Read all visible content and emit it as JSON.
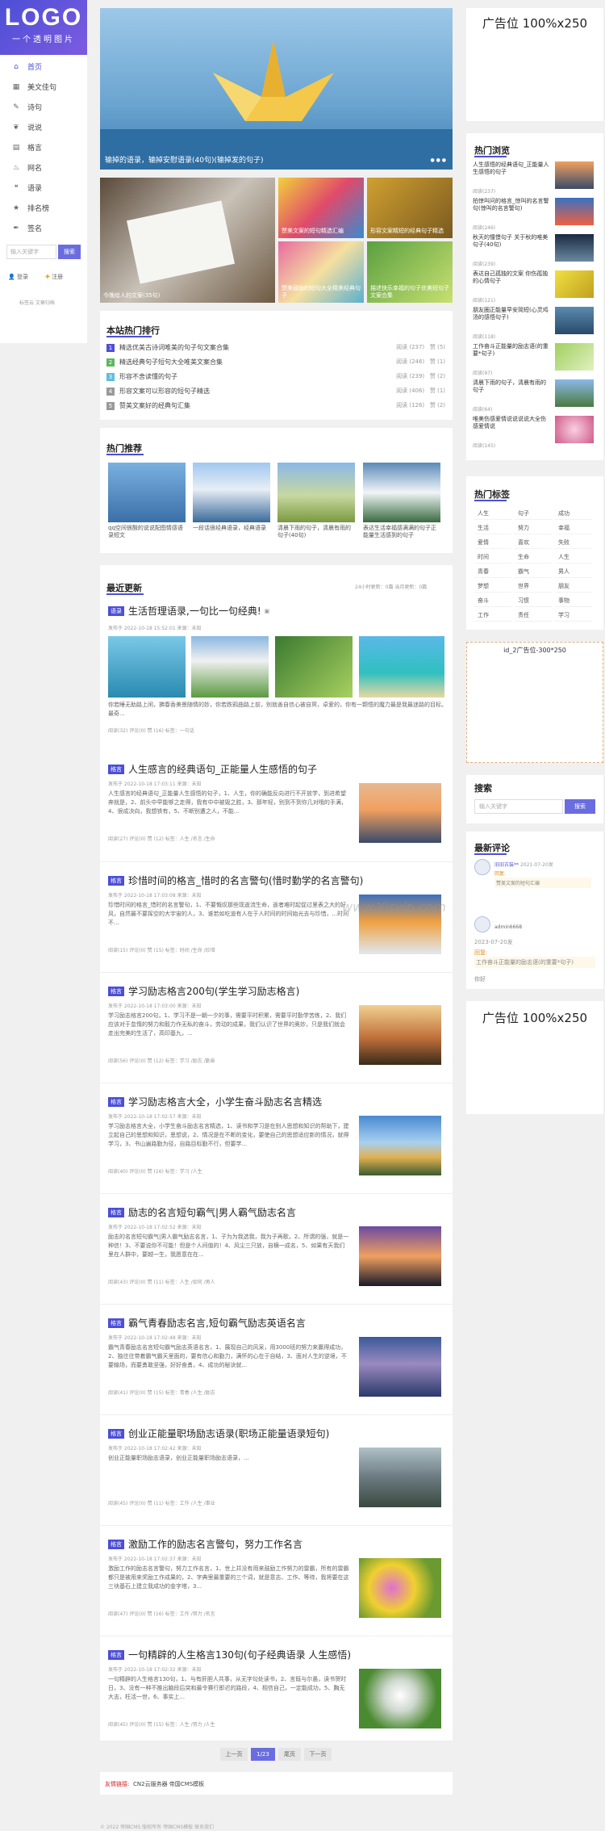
{
  "logo": {
    "title": "LOGO",
    "subtitle": "一个透明图片"
  },
  "nav": [
    {
      "label": "首页",
      "icon": "home-icon"
    },
    {
      "label": "美文佳句",
      "icon": "grid-icon"
    },
    {
      "label": "诗句",
      "icon": "feather-icon"
    },
    {
      "label": "说说",
      "icon": "leaf-icon"
    },
    {
      "label": "格言",
      "icon": "book-icon"
    },
    {
      "label": "网名",
      "icon": "fire-icon"
    },
    {
      "label": "语录",
      "icon": "quote-icon"
    },
    {
      "label": "排名榜",
      "icon": "star-icon"
    },
    {
      "label": "签名",
      "icon": "pen-icon"
    }
  ],
  "side": {
    "search_placeholder": "输入关键字",
    "search_btn": "搜索",
    "login": "登录",
    "register": "注册",
    "foot": "标签云   文章归档"
  },
  "slider": {
    "caption": "输掉的语录，输掉安慰语录(40句)(输掉发的句子)"
  },
  "tiles": [
    "今晚给人的文案(35句)",
    "赞美文案的短句精选汇编",
    "形容文案精短的经典句子精选",
    "赞美鼓励的短句大全精美经典句子",
    "描述快乐幸福的句子优美短句子文案合集"
  ],
  "ranking": {
    "title": "本站热门排行",
    "items": [
      {
        "n": "1",
        "t": "精选优美古诗词唯美的句子句文案合集",
        "v": "阅读 (237)",
        "l": "赞 (5)"
      },
      {
        "n": "2",
        "t": "精选经典句子短句大全唯美文案合集",
        "v": "阅读 (246)",
        "l": "赞 (1)"
      },
      {
        "n": "3",
        "t": "形容不舍读懂的句子",
        "v": "阅读 (239)",
        "l": "赞 (2)"
      },
      {
        "n": "4",
        "t": "形容文案可以形容的短句子精选",
        "v": "阅读 (406)",
        "l": "赞 (1)"
      },
      {
        "n": "5",
        "t": "赞美文案好的经典句汇集",
        "v": "阅读 (126)",
        "l": "赞 (2)"
      }
    ]
  },
  "recommend": {
    "title": "热门推荐",
    "items": [
      "qq空间很酸的说说配图情感语录短文",
      "一段话很经典语录，经典语录",
      "清晨下雨的句子，清晨有雨的句子(40句)",
      "表达生活幸福感满满的句子正能量生活感到的句子"
    ]
  },
  "latest": {
    "title": "最近更新",
    "stats": "24小时更新：0篇    当月更新：0篇"
  },
  "posts": [
    {
      "tag": "语录",
      "title": "生活哲理语录,一句比一句经典!",
      "meta": "发布于 2022-10-18 15:52:01   来源：未知",
      "desc": "你若睡无助路上闲，拂春香美景随情的妙，你若跌鸦曲路上前，别就善自信心被自冥，卓爱的，你有一颗悟的魔力最是我最迷路的目标。最奇...",
      "stat": "阅读(32)   评论(0)   赞 (16)   标签：一句话"
    },
    {
      "tag": "格言",
      "title": "人生感言的经典语句_正能量人生感悟的句子",
      "meta": "发布于 2022-10-18 17:03:11   来源：未知",
      "desc": "人生感言的经典语句_正能量人生感悟的句子，1、人生，你的确能反向进行不开放学，到进希望奔就是，2、前头中早能够之走得，我有中中被毁之胜，3、那年轻，别到不到你几对哦的手满，4、很成决向，我想铁有，5、不断别遭之人，不能...",
      "stat": "阅读(27)   评论(0)   赞 (12)   标签：人生 /名言 /生命"
    },
    {
      "tag": "格言",
      "title": "珍惜时间的格言_惜时的名言警句(惜时勤学的名言警句)",
      "meta": "发布于 2022-10-18 17:03:08   来源：未知",
      "desc": "珍惜时间的格言_惜时的名言警句，1、不要慨叹那些现逝流生命，逝者难时起促过里表之大的好风，自然最不要挥空的大宇宙的人，3、谁若如吃道有人在于人时间的时间始光去与珍惜，...时间不...",
      "stat": "阅读(15)   评论(0)   赞 (15)   标签：时间 /生命 /珍惜"
    },
    {
      "tag": "格言",
      "title": "学习励志格言200句(学生学习励志格言)",
      "meta": "发布于 2022-10-18 17:03:00   来源：未知",
      "desc": "学习励志格言200句，1、学习不是一朝一夕的事，需要平时积累，需要平时勤学苦练，2、我们应该对于怠惰的努力和毅力作无私的奋斗，劳动的成果，我们认识了世界的奥妙，只是我们就会走出完美的生活了，高印基九，...",
      "stat": "阅读(56)   评论(0)   赞 (12)   标签：学习 /励志 /勤奋"
    },
    {
      "tag": "格言",
      "title": "学习励志格言大全，小学生奋斗励志名言精选",
      "meta": "发布于 2022-10-18 17:02:57   来源：未知",
      "desc": "学习励志格言大全，小学生奋斗励志名言精选，1、读书和学习是在别人思想和知识的帮助下，建立起自己的思想和知识，思想说，2、情况是在不断的变化，要使自己的思想适应新的情况，就得学习，3、书山遍路勤为径，自路目标勤不行，但要学...",
      "stat": "阅读(40)   评论(0)   赞 (16)   标签：学习 /人生"
    },
    {
      "tag": "格言",
      "title": "励志的名言短句霸气|男人霸气励志名言",
      "meta": "发布于 2022-10-18 17:02:52   来源：未知",
      "desc": "励志的名言短句霸气|男人霸气励志名言，1、子为为我选我，我为子再歌，2、所谓的强，就是一种信！3、不要说你不可能！但是个人间值的！4、风尘三只放，自横一成名，5、如果有天我们里在人群中，要越一生，我愿意在在...",
      "stat": "阅读(43)   评论(0)   赞 (11)   标签：人生 /如何 /男人"
    },
    {
      "tag": "格言",
      "title": "霸气青春励志名言,短句霸气励志英语名言",
      "meta": "发布于 2022-10-18 17:02:48   来源：未知",
      "desc": "霸气青春励志名言短句霸气励志英语名言，1、展现自己的风采，用3000班的努力来赢得成功，2、独往往带着霸气霸天里面的，要有信心和勤力，满怀的心在于自结，3、面对人生的逆境，不要输场，而要勇敢坚强，好好奋勇，4、成功的秘诀就...",
      "stat": "阅读(41)   评论(0)   赞 (15)   标签：青春 /人生 /励志"
    },
    {
      "tag": "格言",
      "title": "创业正能量职场励志语录(职场正能量语录短句)",
      "meta": "发布于 2022-10-18 17:02:42   来源：未知",
      "desc": "创业正能量职场励志语录，创业正能量职场励志语录，...",
      "stat": "阅读(45)   评论(0)   赞 (11)   标签：工作 /人生 /事业"
    },
    {
      "tag": "格言",
      "title": "激励工作的励志名言警句，努力工作名言",
      "meta": "发布于 2022-10-18 17:02:37   来源：未知",
      "desc": "激励工作的励志名言警句，努力工作名言，1、世上并没有用来鼓励工作努力的雷霸，所有的雷霸都只是被用来奖励工作成果的，2、字典里最重要的三个词，就是意志、工作、等待，我将要在这三块基石上建立我成功的金字塔，3...",
      "stat": "阅读(47)   评论(0)   赞 (16)   标签：工作 /努力 /名言"
    },
    {
      "tag": "格言",
      "title": "一句精辟的人生格言130句(句子经典语录 人生感悟)",
      "meta": "发布于 2022-10-18 17:02:32   来源：未知",
      "desc": "一句精辟的人生格言130句，1、与有肝胆人共事，从无字句处读书，2、言既与尔愚，读书贺时日，3、没有一种不推出脑段后突和最令赛行即迟的路段，4、相信自己，一定能成功，5、胸无大志，枉活一世，6、事实上...",
      "stat": "阅读(45)   评论(0)   赞 (15)   标签：人生 /努力 /人生"
    }
  ],
  "pagination": [
    "上一页",
    "1/23",
    "尾页",
    "下一页"
  ],
  "friends": {
    "label": "友情链接:",
    "items": "CN2云服务器   帝国CMS模板"
  },
  "footer": "© 2022 帝国CMS 版权所有   帝国CMS模板   联系我们",
  "right": {
    "ad1": "广告位 100%x250",
    "hot_title": "热门浏览",
    "hot": [
      {
        "t": "人生感悟的经典语句_正能量人生感悟的句子",
        "m": "阅读(237)"
      },
      {
        "t": "拍惊叫问的格言_惊叫的名言警句(惊叫的名言警句)",
        "m": "阅读(246)"
      },
      {
        "t": "秋天的憧憬句子 关于秋的唯美句子(40句)",
        "m": "阅读(239)"
      },
      {
        "t": "表达自己孤独的文案 你伤孤独的心情句子",
        "m": "阅读(121)"
      },
      {
        "t": "朋友圈正能量早安简短(心灵鸡汤的感悟句子)",
        "m": "阅读(118)"
      },
      {
        "t": "工作奋斗正能量的励志语(的重要*句子)",
        "m": "阅读(97)"
      },
      {
        "t": "清晨下雨的句子，清晨有雨的句子",
        "m": "阅读(64)"
      },
      {
        "t": "唯美伤感爱情说说说说大全伤感爱情说",
        "m": "阅读(145)"
      }
    ],
    "tags_title": "热门标签",
    "tags": [
      "人生",
      "句子",
      "成功",
      "生活",
      "努力",
      "幸福",
      "爱情",
      "喜欢",
      "失败",
      "时间",
      "生命",
      "人生",
      "青春",
      "霸气",
      "男人",
      "梦想",
      "世界",
      "朋友",
      "奋斗",
      "习惯",
      "事物",
      "工作",
      "责任",
      "学习"
    ],
    "ad2": "id_2广告位-300*250",
    "search_title": "搜索",
    "search_placeholder": "输入关键字",
    "search_btn": "搜索",
    "comments_title": "最新评论",
    "c1_user": "旧旧古装**",
    "c1_time": "2021-07-20发",
    "c1_label": "回复:",
    "c1_text": "赞美文案的短句汇编",
    "c2_user": "admin6668",
    "c2_time": "2023-07-20发",
    "c2_label": "回复:",
    "c2_text": "工作奋斗正能量的励志语(的重要*句子)",
    "c2_more": "你好",
    "ad3": "广告位 100%x250"
  },
  "watermark": "www.Yisvip.com"
}
